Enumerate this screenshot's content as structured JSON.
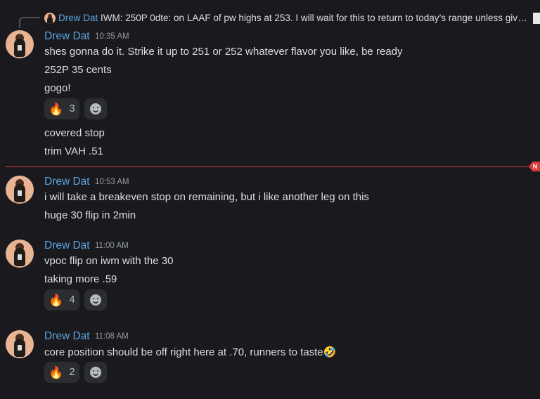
{
  "reply": {
    "author": "Drew Dat",
    "text": "IWM: 250P 0dte: on LAAF of pw highs at 253. I will wait for this to return to today’s range unless given..."
  },
  "new_badge": "N",
  "messages": [
    {
      "author": "Drew Dat",
      "time": "10:35 AM",
      "lines": [
        "shes gonna do it. Strike it up to 251 or 252 whatever flavor you like, be ready",
        "252P 35 cents",
        "gogo!"
      ],
      "reaction": {
        "emoji": "🔥",
        "count": "3"
      },
      "lines_after": [
        "covered stop",
        "trim VAH .51"
      ]
    },
    {
      "author": "Drew Dat",
      "time": "10:53 AM",
      "lines": [
        "i will take a breakeven stop on remaining, but i like another leg on this",
        "huge 30 flip in 2min"
      ]
    },
    {
      "author": "Drew Dat",
      "time": "11:00 AM",
      "lines": [
        "vpoc flip on iwm with the 30",
        "taking more .59"
      ],
      "reaction": {
        "emoji": "🔥",
        "count": "4"
      }
    },
    {
      "author": "Drew Dat",
      "time": "11:08 AM",
      "lines": [
        "core position should be off right here at .70, runners to taste🤣"
      ],
      "reaction": {
        "emoji": "🔥",
        "count": "2"
      }
    }
  ]
}
